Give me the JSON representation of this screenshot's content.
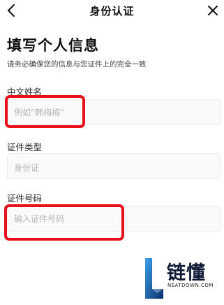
{
  "header": {
    "title": "身份认证"
  },
  "page": {
    "heading": "填写个人信息",
    "subheading": "请务必确保您的信息与您证件上的完全一致"
  },
  "form": {
    "name": {
      "label": "中文姓名",
      "placeholder": "例如“韩梅梅”",
      "value": ""
    },
    "id_type": {
      "label": "证件类型",
      "value": "身份证"
    },
    "id_number": {
      "label": "证件号码",
      "placeholder": "输入证件号码",
      "value": ""
    }
  },
  "annotation": {
    "color": "#e8111b"
  },
  "watermark": {
    "brand": "链懂",
    "domain": "NEATDOWN.COM"
  },
  "icons": {
    "back": "chevron-left-icon",
    "close": "close-icon"
  }
}
